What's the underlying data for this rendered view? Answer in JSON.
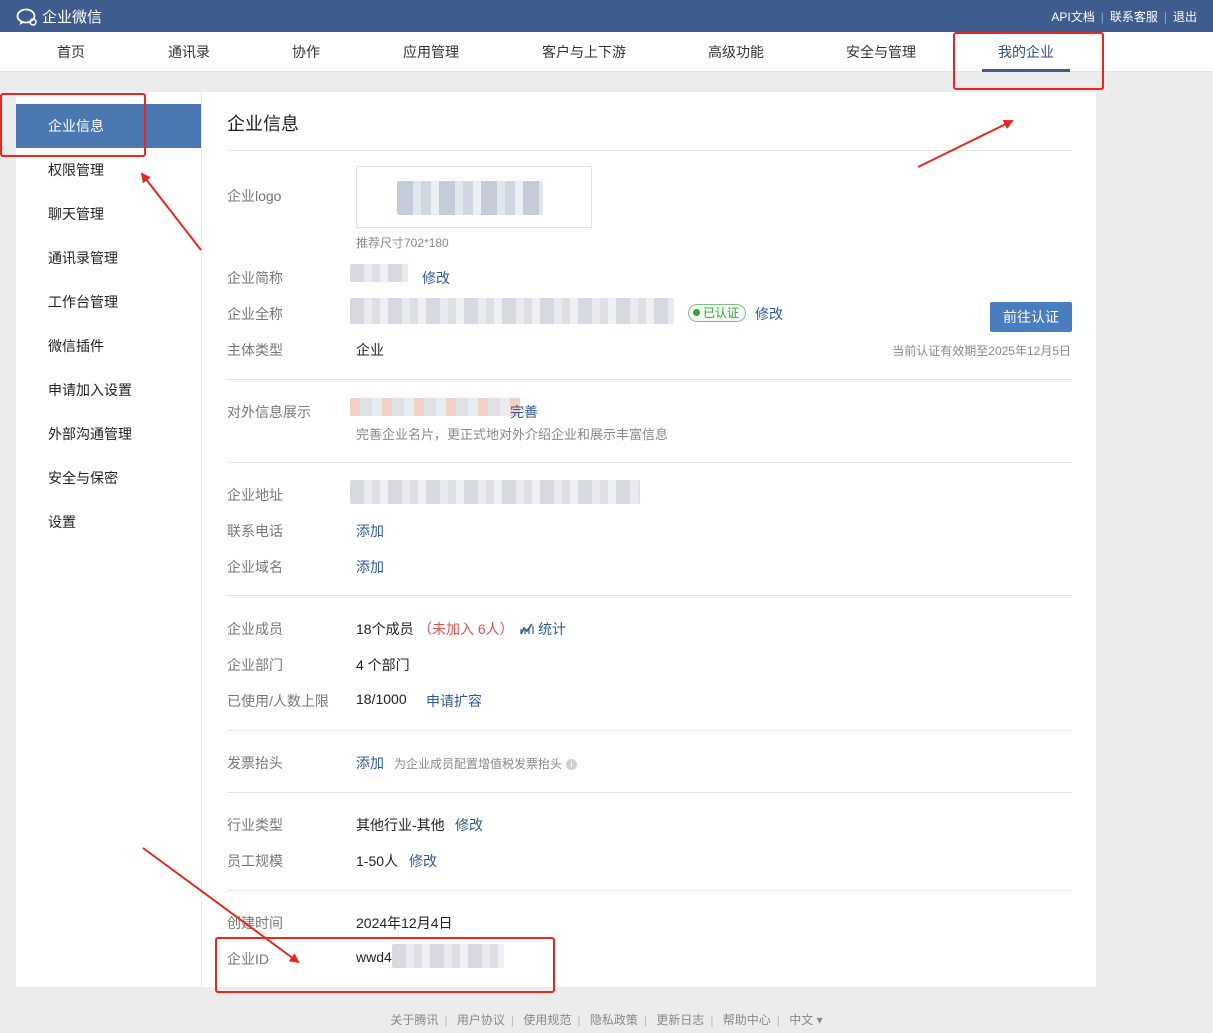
{
  "app": {
    "title": "企业微信"
  },
  "toplinks": {
    "api_doc": "API文档",
    "contact": "联系客服",
    "logout": "退出",
    "sep": "|"
  },
  "nav": [
    "首页",
    "通讯录",
    "协作",
    "应用管理",
    "客户与上下游",
    "高级功能",
    "安全与管理",
    "我的企业"
  ],
  "nav_active": "我的企业",
  "sidebar": [
    "企业信息",
    "权限管理",
    "聊天管理",
    "通讯录管理",
    "工作台管理",
    "微信插件",
    "申请加入设置",
    "外部沟通管理",
    "安全与保密",
    "设置"
  ],
  "sidebar_active": "企业信息",
  "main": {
    "title": "企业信息",
    "logo": {
      "label": "企业logo",
      "hint": "推荐尺寸702*180"
    },
    "short_name": {
      "label": "企业简称",
      "action": "修改"
    },
    "full_name": {
      "label": "企业全称",
      "badge": "已认证",
      "action": "修改"
    },
    "entity_type": {
      "label": "主体类型",
      "value": "企业"
    },
    "verify_button": "前往认证",
    "verify_expiry": "当前认证有效期至2025年12月5日",
    "external_info": {
      "label": "对外信息展示",
      "link_tail": "完善",
      "desc": "完善企业名片，更正式地对外介绍企业和展示丰富信息"
    },
    "address": {
      "label": "企业地址"
    },
    "phone": {
      "label": "联系电话",
      "action": "添加"
    },
    "domain": {
      "label": "企业域名",
      "action": "添加"
    },
    "members": {
      "label": "企业成员",
      "value": "18个成员",
      "unjoined": "（未加入 6人）",
      "stats": "统计"
    },
    "departments": {
      "label": "企业部门",
      "value": "4 个部门"
    },
    "capacity": {
      "label": "已使用/人数上限",
      "value": "18/1000",
      "action": "申请扩容"
    },
    "invoice": {
      "label": "发票抬头",
      "action": "添加",
      "hint": "为企业成员配置增值税发票抬头"
    },
    "industry": {
      "label": "行业类型",
      "value": "其他行业-其他",
      "action": "修改"
    },
    "scale": {
      "label": "员工规模",
      "value": "1-50人",
      "action": "修改"
    },
    "created": {
      "label": "创建时间",
      "value": "2024年12月4日"
    },
    "corp_id": {
      "label": "企业ID",
      "value": "wwd4"
    }
  },
  "footer": [
    "关于腾讯",
    "用户协议",
    "使用规范",
    "隐私政策",
    "更新日志",
    "帮助中心",
    "中文 ▾"
  ],
  "colors": {
    "topbar": "#3f5c8f",
    "accent": "#4a7cc0",
    "link": "#2d5b97",
    "annotation": "#e8281f",
    "verified": "#3a9d3a",
    "warning": "#e0524a"
  }
}
